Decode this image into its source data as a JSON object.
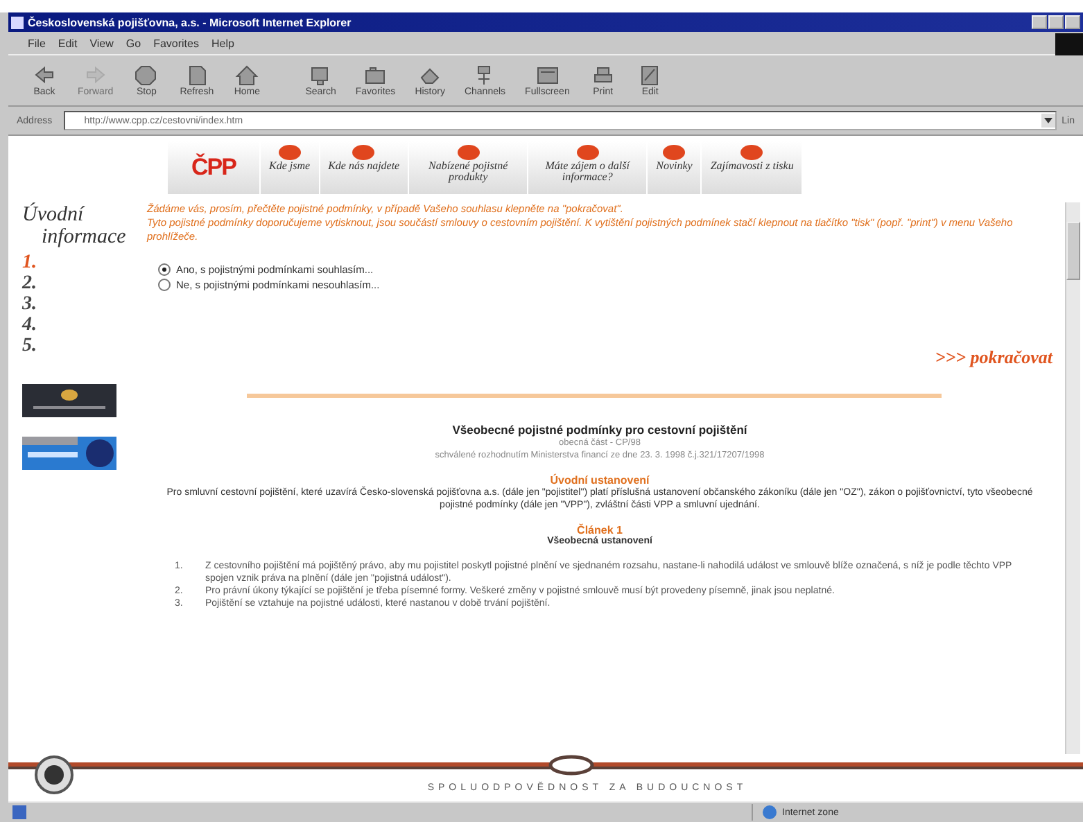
{
  "window": {
    "title": "Československá pojišťovna, a.s. - Microsoft Internet Explorer"
  },
  "menu": [
    "File",
    "Edit",
    "View",
    "Go",
    "Favorites",
    "Help"
  ],
  "toolbar": [
    {
      "label": "Back",
      "kind": "back"
    },
    {
      "label": "Forward",
      "kind": "forward",
      "disabled": true
    },
    {
      "label": "Stop",
      "kind": "stop"
    },
    {
      "label": "Refresh",
      "kind": "refresh"
    },
    {
      "label": "Home",
      "kind": "home"
    },
    {
      "label": "Search",
      "kind": "search"
    },
    {
      "label": "Favorites",
      "kind": "favorites"
    },
    {
      "label": "History",
      "kind": "history"
    },
    {
      "label": "Channels",
      "kind": "channels"
    },
    {
      "label": "Fullscreen",
      "kind": "fullscreen"
    },
    {
      "label": "Print",
      "kind": "print"
    },
    {
      "label": "Edit",
      "kind": "edit"
    }
  ],
  "address": {
    "label": "Address",
    "value": "http://www.cpp.cz/cestovni/index.htm",
    "links": "Lin"
  },
  "nav": {
    "logo": "ČPP",
    "items": [
      {
        "label": "Kde jsme"
      },
      {
        "label": "Kde nás najdete"
      },
      {
        "label": "Nabízené pojistné produkty"
      },
      {
        "label": "Máte zájem o další informace?"
      },
      {
        "label": "Novinky"
      },
      {
        "label": "Zajímavosti z tisku"
      }
    ]
  },
  "steps": {
    "title_1": "Úvodní",
    "title_2": "informace",
    "items": [
      {
        "label": "1.",
        "selected": true
      },
      {
        "label": "2.",
        "selected": false
      },
      {
        "label": "3.",
        "selected": false
      },
      {
        "label": "4.",
        "selected": false
      },
      {
        "label": "5.",
        "selected": false
      }
    ]
  },
  "intro": [
    "Žádáme vás, prosím, přečtěte pojistné podmínky, v případě Vašeho souhlasu klepněte na \"pokračovat\".",
    "Tyto pojistné podmínky doporučujeme vytisknout, jsou součástí smlouvy o cestovním pojištění. K vytištění pojistných podmínek stačí klepnout na tlačítko \"tisk\" (popř. \"print\") v menu Vašeho prohlížeče."
  ],
  "consent": [
    {
      "label": "Ano, s pojistnými podmínkami souhlasím...",
      "selected": true
    },
    {
      "label": "Ne, s pojistnými podmínkami nesouhlasím...",
      "selected": false
    }
  ],
  "continue": ">>> pokračovat",
  "document": {
    "title": "Všeobecné pojistné podmínky pro cestovní pojištění",
    "subtitle": "obecná část - CP/98",
    "approval": "schválené rozhodnutím Ministerstva financí ze dne 23. 3. 1998 č.j.321/17207/1998",
    "intro_heading": "Úvodní ustanovení",
    "intro_text": "Pro smluvní cestovní pojištění, které uzavírá Česko-slovenská pojišťovna a.s. (dále jen \"pojistitel\") platí příslušná ustanovení občanského zákoníku (dále jen \"OZ\"), zákon o pojišťovnictví, tyto všeobecné pojistné podmínky (dále jen \"VPP\"), zvláštní části VPP a smluvní ujednání.",
    "article_number": "Článek 1",
    "article_title": "Všeobecná ustanovení",
    "clauses": [
      {
        "number": "1.",
        "text": "Z cestovního pojištění má pojištěný právo, aby mu pojistitel poskytl pojistné plnění ve sjednaném rozsahu, nastane-li nahodilá událost ve smlouvě blíže označená, s níž je podle těchto VPP spojen vznik práva na plnění (dále jen \"pojistná událost\")."
      },
      {
        "number": "2.",
        "text": "Pro právní úkony týkající se pojištění je třeba písemné formy. Veškeré změny v pojistné smlouvě musí být provedeny písemně, jinak jsou neplatné."
      },
      {
        "number": "3.",
        "text": "Pojištění se vztahuje na pojistné události, které nastanou v době trvání pojištění."
      }
    ]
  },
  "footer": {
    "slogan": "SPOLUODPOVĚDNOST ZA BUDOUCNOST"
  },
  "status_bar": {
    "zone": "Internet zone"
  }
}
